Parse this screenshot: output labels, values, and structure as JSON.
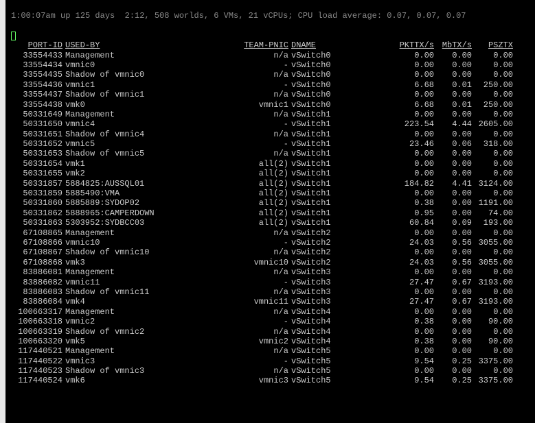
{
  "uptime_line": "1:00:07am up 125 days  2:12, 508 worlds, 6 VMs, 21 vCPUs; CPU load average: 0.07, 0.07, 0.07",
  "headers": {
    "port": "PORT-ID",
    "used": "USED-BY",
    "team": "TEAM-PNIC",
    "dname": "DNAME",
    "pkt": "PKTTX/s",
    "mbtx": "MbTX/s",
    "psztx": "PSZTX"
  },
  "rows": [
    {
      "port": "33554433",
      "used": "Management",
      "team": "n/a",
      "dname": "vSwitch0",
      "pkt": "0.00",
      "mbtx": "0.00",
      "psztx": "0.00"
    },
    {
      "port": "33554434",
      "used": "vmnic0",
      "team": "-",
      "dname": "vSwitch0",
      "pkt": "0.00",
      "mbtx": "0.00",
      "psztx": "0.00"
    },
    {
      "port": "33554435",
      "used": "Shadow of vmnic0",
      "team": "n/a",
      "dname": "vSwitch0",
      "pkt": "0.00",
      "mbtx": "0.00",
      "psztx": "0.00"
    },
    {
      "port": "33554436",
      "used": "vmnic1",
      "team": "-",
      "dname": "vSwitch0",
      "pkt": "6.68",
      "mbtx": "0.01",
      "psztx": "250.00"
    },
    {
      "port": "33554437",
      "used": "Shadow of vmnic1",
      "team": "n/a",
      "dname": "vSwitch0",
      "pkt": "0.00",
      "mbtx": "0.00",
      "psztx": "0.00"
    },
    {
      "port": "33554438",
      "used": "vmk0",
      "team": "vmnic1",
      "dname": "vSwitch0",
      "pkt": "6.68",
      "mbtx": "0.01",
      "psztx": "250.00"
    },
    {
      "port": "50331649",
      "used": "Management",
      "team": "n/a",
      "dname": "vSwitch1",
      "pkt": "0.00",
      "mbtx": "0.00",
      "psztx": "0.00"
    },
    {
      "port": "50331650",
      "used": "vmnic4",
      "team": "-",
      "dname": "vSwitch1",
      "pkt": "223.54",
      "mbtx": "4.44",
      "psztx": "2605.00"
    },
    {
      "port": "50331651",
      "used": "Shadow of vmnic4",
      "team": "n/a",
      "dname": "vSwitch1",
      "pkt": "0.00",
      "mbtx": "0.00",
      "psztx": "0.00"
    },
    {
      "port": "50331652",
      "used": "vmnic5",
      "team": "-",
      "dname": "vSwitch1",
      "pkt": "23.46",
      "mbtx": "0.06",
      "psztx": "318.00"
    },
    {
      "port": "50331653",
      "used": "Shadow of vmnic5",
      "team": "n/a",
      "dname": "vSwitch1",
      "pkt": "0.00",
      "mbtx": "0.00",
      "psztx": "0.00"
    },
    {
      "port": "50331654",
      "used": "vmk1",
      "team": "all(2)",
      "dname": "vSwitch1",
      "pkt": "0.00",
      "mbtx": "0.00",
      "psztx": "0.00"
    },
    {
      "port": "50331655",
      "used": "vmk2",
      "team": "all(2)",
      "dname": "vSwitch1",
      "pkt": "0.00",
      "mbtx": "0.00",
      "psztx": "0.00"
    },
    {
      "port": "50331857",
      "used": "5884825:AUSSQL01",
      "team": "all(2)",
      "dname": "vSwitch1",
      "pkt": "184.82",
      "mbtx": "4.41",
      "psztx": "3124.00"
    },
    {
      "port": "50331859",
      "used": "5885490:VMA",
      "team": "all(2)",
      "dname": "vSwitch1",
      "pkt": "0.00",
      "mbtx": "0.00",
      "psztx": "0.00"
    },
    {
      "port": "50331860",
      "used": "5885889:SYDOP02",
      "team": "all(2)",
      "dname": "vSwitch1",
      "pkt": "0.38",
      "mbtx": "0.00",
      "psztx": "1191.00"
    },
    {
      "port": "50331862",
      "used": "5888965:CAMPERDOWN",
      "team": "all(2)",
      "dname": "vSwitch1",
      "pkt": "0.95",
      "mbtx": "0.00",
      "psztx": "74.00"
    },
    {
      "port": "50331863",
      "used": "5303952:SYDBCC03",
      "team": "all(2)",
      "dname": "vSwitch1",
      "pkt": "60.84",
      "mbtx": "0.09",
      "psztx": "193.00"
    },
    {
      "port": "67108865",
      "used": "Management",
      "team": "n/a",
      "dname": "vSwitch2",
      "pkt": "0.00",
      "mbtx": "0.00",
      "psztx": "0.00"
    },
    {
      "port": "67108866",
      "used": "vmnic10",
      "team": "-",
      "dname": "vSwitch2",
      "pkt": "24.03",
      "mbtx": "0.56",
      "psztx": "3055.00"
    },
    {
      "port": "67108867",
      "used": "Shadow of vmnic10",
      "team": "n/a",
      "dname": "vSwitch2",
      "pkt": "0.00",
      "mbtx": "0.00",
      "psztx": "0.00"
    },
    {
      "port": "67108868",
      "used": "vmk3",
      "team": "vmnic10",
      "dname": "vSwitch2",
      "pkt": "24.03",
      "mbtx": "0.56",
      "psztx": "3055.00"
    },
    {
      "port": "83886081",
      "used": "Management",
      "team": "n/a",
      "dname": "vSwitch3",
      "pkt": "0.00",
      "mbtx": "0.00",
      "psztx": "0.00"
    },
    {
      "port": "83886082",
      "used": "vmnic11",
      "team": "-",
      "dname": "vSwitch3",
      "pkt": "27.47",
      "mbtx": "0.67",
      "psztx": "3193.00"
    },
    {
      "port": "83886083",
      "used": "Shadow of vmnic11",
      "team": "n/a",
      "dname": "vSwitch3",
      "pkt": "0.00",
      "mbtx": "0.00",
      "psztx": "0.00"
    },
    {
      "port": "83886084",
      "used": "vmk4",
      "team": "vmnic11",
      "dname": "vSwitch3",
      "pkt": "27.47",
      "mbtx": "0.67",
      "psztx": "3193.00"
    },
    {
      "port": "100663317",
      "used": "Management",
      "team": "n/a",
      "dname": "vSwitch4",
      "pkt": "0.00",
      "mbtx": "0.00",
      "psztx": "0.00"
    },
    {
      "port": "100663318",
      "used": "vmnic2",
      "team": "-",
      "dname": "vSwitch4",
      "pkt": "0.38",
      "mbtx": "0.00",
      "psztx": "90.00"
    },
    {
      "port": "100663319",
      "used": "Shadow of vmnic2",
      "team": "n/a",
      "dname": "vSwitch4",
      "pkt": "0.00",
      "mbtx": "0.00",
      "psztx": "0.00"
    },
    {
      "port": "100663320",
      "used": "vmk5",
      "team": "vmnic2",
      "dname": "vSwitch4",
      "pkt": "0.38",
      "mbtx": "0.00",
      "psztx": "90.00"
    },
    {
      "port": "117440521",
      "used": "Management",
      "team": "n/a",
      "dname": "vSwitch5",
      "pkt": "0.00",
      "mbtx": "0.00",
      "psztx": "0.00"
    },
    {
      "port": "117440522",
      "used": "vmnic3",
      "team": "-",
      "dname": "vSwitch5",
      "pkt": "9.54",
      "mbtx": "0.25",
      "psztx": "3375.00"
    },
    {
      "port": "117440523",
      "used": "Shadow of vmnic3",
      "team": "n/a",
      "dname": "vSwitch5",
      "pkt": "0.00",
      "mbtx": "0.00",
      "psztx": "0.00"
    },
    {
      "port": "117440524",
      "used": "vmk6",
      "team": "vmnic3",
      "dname": "vSwitch5",
      "pkt": "9.54",
      "mbtx": "0.25",
      "psztx": "3375.00"
    }
  ]
}
